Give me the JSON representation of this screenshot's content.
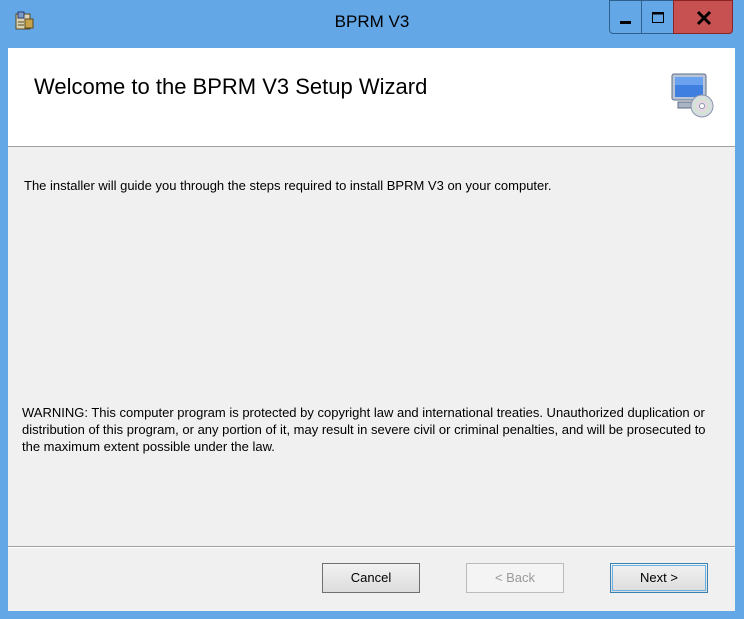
{
  "window": {
    "title": "BPRM V3"
  },
  "titlebar_buttons": {
    "minimize_icon": "minimize-icon",
    "maximize_icon": "maximize-icon",
    "close_icon": "close-icon"
  },
  "banner": {
    "heading": "Welcome to the BPRM V3 Setup Wizard",
    "icon": "computer-cd-icon"
  },
  "body": {
    "intro": "The installer will guide you through the steps required to install BPRM V3 on your computer.",
    "warning": "WARNING: This computer program is protected by copyright law and international treaties. Unauthorized duplication or distribution of this program, or any portion of it, may result in severe civil or criminal penalties, and will be prosecuted to the maximum extent possible under the law."
  },
  "buttons": {
    "cancel": "Cancel",
    "back": "< Back",
    "next": "Next >"
  }
}
